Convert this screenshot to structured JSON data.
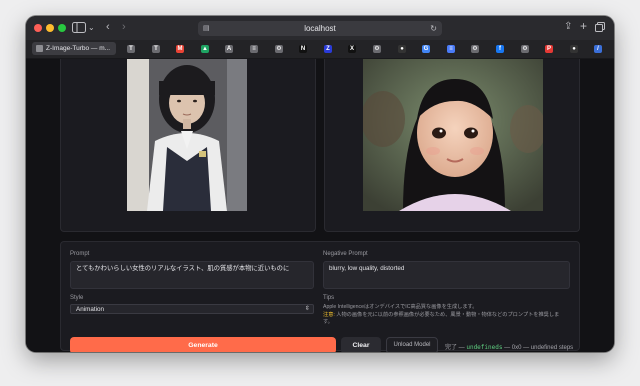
{
  "browser": {
    "url": "localhost",
    "active_tab_title": "Z-Image-Turbo — m..."
  },
  "tabs": [
    {
      "icon": "generic-icon",
      "label": "T",
      "color": "#6b6b70"
    },
    {
      "icon": "generic-icon",
      "label": "T",
      "color": "#6b6b70"
    },
    {
      "icon": "gmail-icon",
      "label": "M",
      "color": "#ea4335"
    },
    {
      "icon": "drive-icon",
      "label": "▲",
      "color": "#1fa463"
    },
    {
      "icon": "generic-icon",
      "label": "A",
      "color": "#6b6b70"
    },
    {
      "icon": "generic-icon",
      "label": "≡",
      "color": "#6b6b70"
    },
    {
      "icon": "gear-icon",
      "label": "⚙",
      "color": "#6b6b70"
    },
    {
      "icon": "notion-icon",
      "label": "N",
      "color": "#111111"
    },
    {
      "icon": "app-icon",
      "label": "Z",
      "color": "#2a3bd8"
    },
    {
      "icon": "x-icon",
      "label": "X",
      "color": "#111111"
    },
    {
      "icon": "gear-icon",
      "label": "⚙",
      "color": "#6b6b70"
    },
    {
      "icon": "github-icon",
      "label": "●",
      "color": "#333333"
    },
    {
      "icon": "google-icon",
      "label": "G",
      "color": "#4285f4"
    },
    {
      "icon": "docs-icon",
      "label": "≡",
      "color": "#4a7bf7"
    },
    {
      "icon": "gear-icon",
      "label": "⚙",
      "color": "#6b6b70"
    },
    {
      "icon": "facebook-icon",
      "label": "f",
      "color": "#1877f2"
    },
    {
      "icon": "gear-icon",
      "label": "⚙",
      "color": "#6b6b70"
    },
    {
      "icon": "app-icon",
      "label": "P",
      "color": "#e53935"
    },
    {
      "icon": "github-icon",
      "label": "●",
      "color": "#333333"
    },
    {
      "icon": "app-icon",
      "label": "/",
      "color": "#3b6fd8"
    },
    {
      "icon": "gear-icon",
      "label": "⚙",
      "color": "#6b6b70"
    }
  ],
  "form": {
    "prompt_label": "Prompt",
    "prompt_value": "とてもかわいらしい女性のリアルなイラスト、肌の質感が本物に近いものに",
    "negative_label": "Negative Prompt",
    "negative_value": "blurry, low quality, distorted",
    "style_label": "Style",
    "style_value": "Animation",
    "tips_label": "Tips",
    "tips_line1": "Apple IntelligenceはオンデバイスでIC高品質な画像を生成します。",
    "tips_note": "注意:",
    "tips_line2": "人物の画像を元に以前の参照画像が必要なため、風景・動物・物体などのプロンプトを推奨しま",
    "tips_line3": "す。"
  },
  "actions": {
    "generate": "Generate",
    "clear": "Clear",
    "unload": "Unload Model"
  },
  "status": {
    "prefix": "完了 — ",
    "code": "undefineds",
    "suffix": " — 0x0 — undefined steps"
  },
  "colors": {
    "accent": "#ff6b4a",
    "background": "#121215",
    "card": "#1b1b20",
    "status_code": "#5fcf80"
  }
}
